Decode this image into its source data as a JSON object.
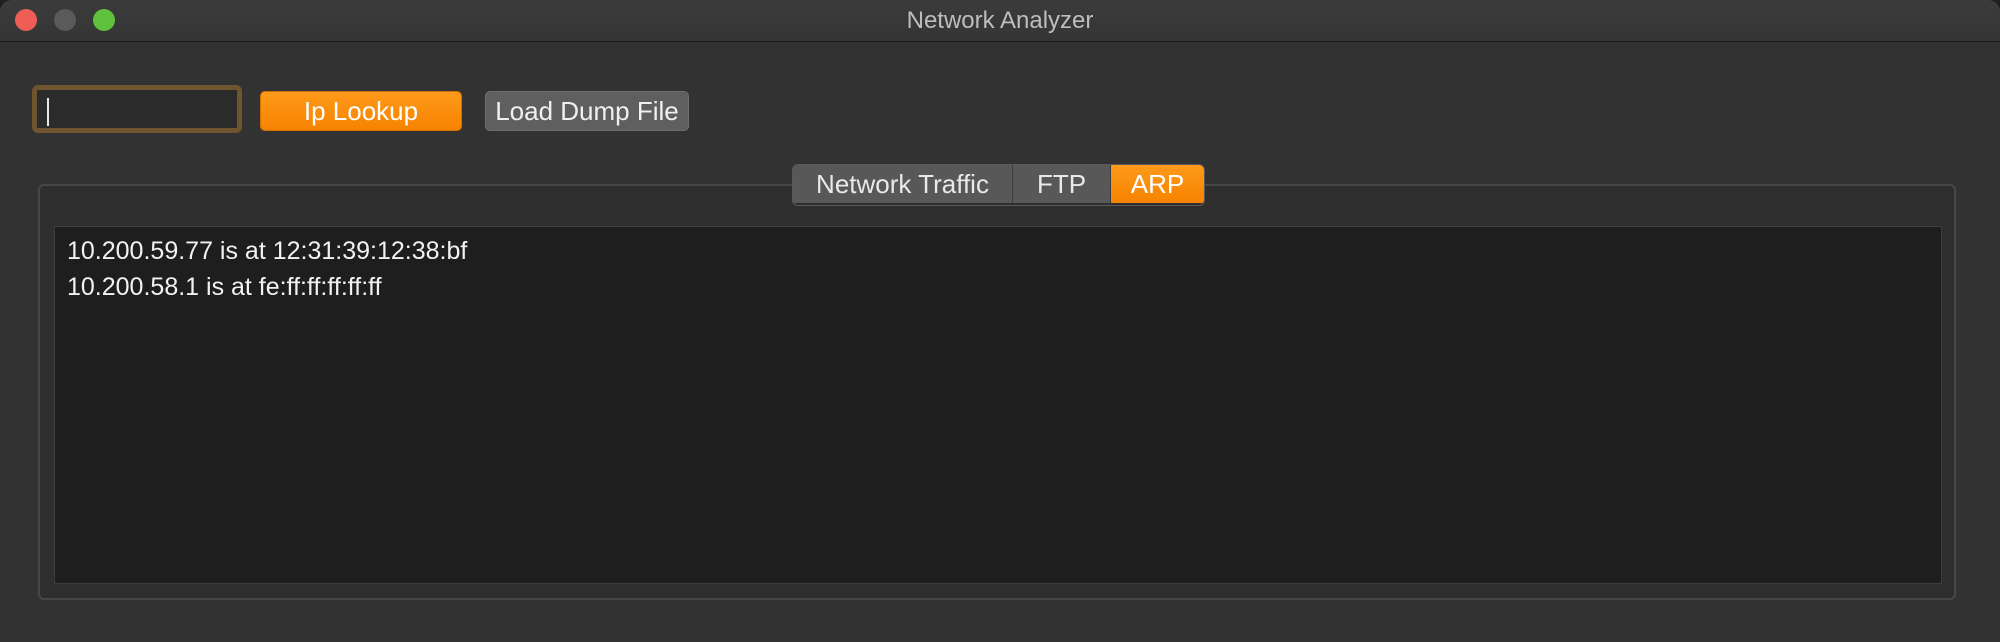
{
  "window": {
    "title": "Network Analyzer"
  },
  "toolbar": {
    "ip_input_value": "",
    "ip_lookup_label": "Ip Lookup",
    "load_dump_label": "Load Dump File"
  },
  "tabs": [
    {
      "label": "Network Traffic",
      "active": false
    },
    {
      "label": "FTP",
      "active": false
    },
    {
      "label": "ARP",
      "active": true
    }
  ],
  "output": {
    "lines": [
      "10.200.59.77 is at 12:31:39:12:38:bf",
      "10.200.58.1 is at fe:ff:ff:ff:ff:ff"
    ]
  },
  "colors": {
    "accent": "#f68300",
    "close": "#ee5e57",
    "maximize": "#5fc23f"
  }
}
